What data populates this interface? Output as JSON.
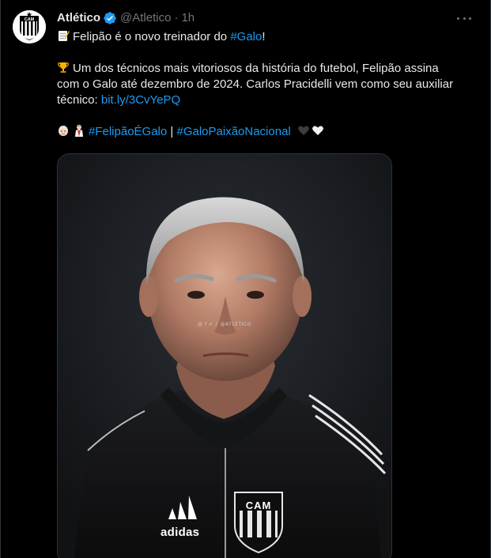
{
  "tweet": {
    "author_name": "Atlético",
    "handle": "@Atletico",
    "separator": "·",
    "time": "1h",
    "line1_text": "Felipão é o novo treinador do ",
    "line1_hashtag": "#Galo",
    "line1_end": "!",
    "para2_line1": "Um dos técnicos mais vitoriosos da história do futebol, Felipão assina",
    "para2_line2": "com o Galo até dezembro de 2024. Carlos Pracidelli vem como seu auxiliar",
    "para2_line3_text": "técnico: ",
    "para2_link": "bit.ly/3CvYePQ",
    "hashtag1": "#FelipãoÉGalo",
    "hashtag_sep": "|",
    "hashtag2": "#GaloPaixãoNacional"
  },
  "avatar": {
    "crest_text": "CAM"
  },
  "media": {
    "social_caption": "@ f ✔ ♪ @ATLETICO",
    "jacket_brand": "adidas",
    "crest_text": "CAM"
  },
  "icons": {
    "verified": "verified-badge-icon",
    "more": "more-options-icon",
    "memo": "memo-emoji-icon",
    "trophy": "trophy-emoji-icon",
    "old_man": "old-man-emoji-icon",
    "person": "person-emoji-icon",
    "black_heart": "black-heart-emoji-icon",
    "white_heart": "white-heart-emoji-icon"
  },
  "colors": {
    "background": "#000000",
    "text": "#e7e9ea",
    "muted": "#71767b",
    "link": "#1d9bf0",
    "border": "#2f3336"
  }
}
